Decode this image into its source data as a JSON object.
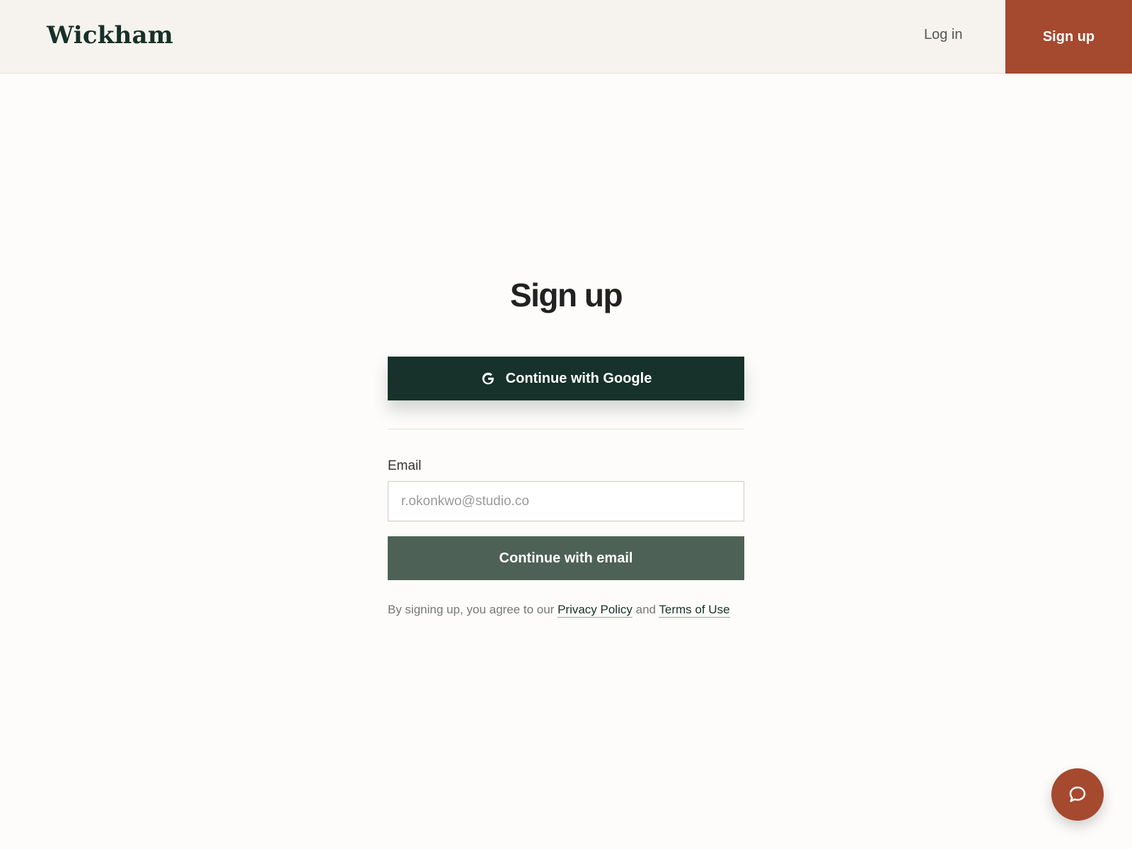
{
  "header": {
    "logo_text": "Wickham",
    "login_label": "Log in",
    "signup_label": "Sign up"
  },
  "main": {
    "title": "Sign up",
    "google_button_label": "Continue with Google",
    "email_label": "Email",
    "email_placeholder": "r.okonkwo@studio.co",
    "email_value": "",
    "email_button_label": "Continue with email",
    "legal": {
      "prefix": "By signing up, you agree to our",
      "privacy_label": "Privacy Policy",
      "conjunction": "and",
      "terms_label": "Terms of Use"
    }
  },
  "icons": {
    "google": "google-icon",
    "chat": "chat-bubble-icon"
  },
  "colors": {
    "brand_dark": "#17322a",
    "brand_accent": "#a5492f",
    "email_button": "#4e6157",
    "header_bg": "#f6f3ee",
    "page_bg": "#fdfcfa"
  }
}
